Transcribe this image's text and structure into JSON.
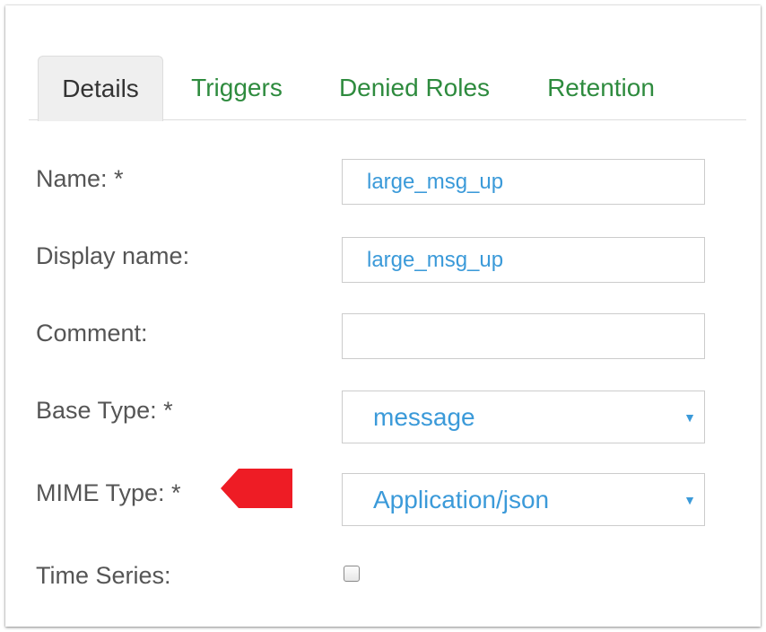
{
  "tabs": [
    {
      "label": "Details",
      "active": true
    },
    {
      "label": "Triggers",
      "active": false
    },
    {
      "label": "Denied Roles",
      "active": false
    },
    {
      "label": "Retention",
      "active": false
    }
  ],
  "form": {
    "name": {
      "label": "Name: *",
      "value": "large_msg_up"
    },
    "display_name": {
      "label": "Display name:",
      "value": "large_msg_up"
    },
    "comment": {
      "label": "Comment:",
      "value": ""
    },
    "base_type": {
      "label": "Base Type: *",
      "selected": "message"
    },
    "mime_type": {
      "label": "MIME Type: *",
      "selected": "Application/json"
    },
    "time_series": {
      "label": "Time Series:",
      "checked": false
    }
  },
  "colors": {
    "tab_link": "#2e8b3e",
    "field_text": "#3b9ad9",
    "annotation_arrow": "#ee1c25"
  },
  "icons": {
    "select_caret": "caret-down-icon",
    "annotation": "red-arrow-left-icon"
  }
}
